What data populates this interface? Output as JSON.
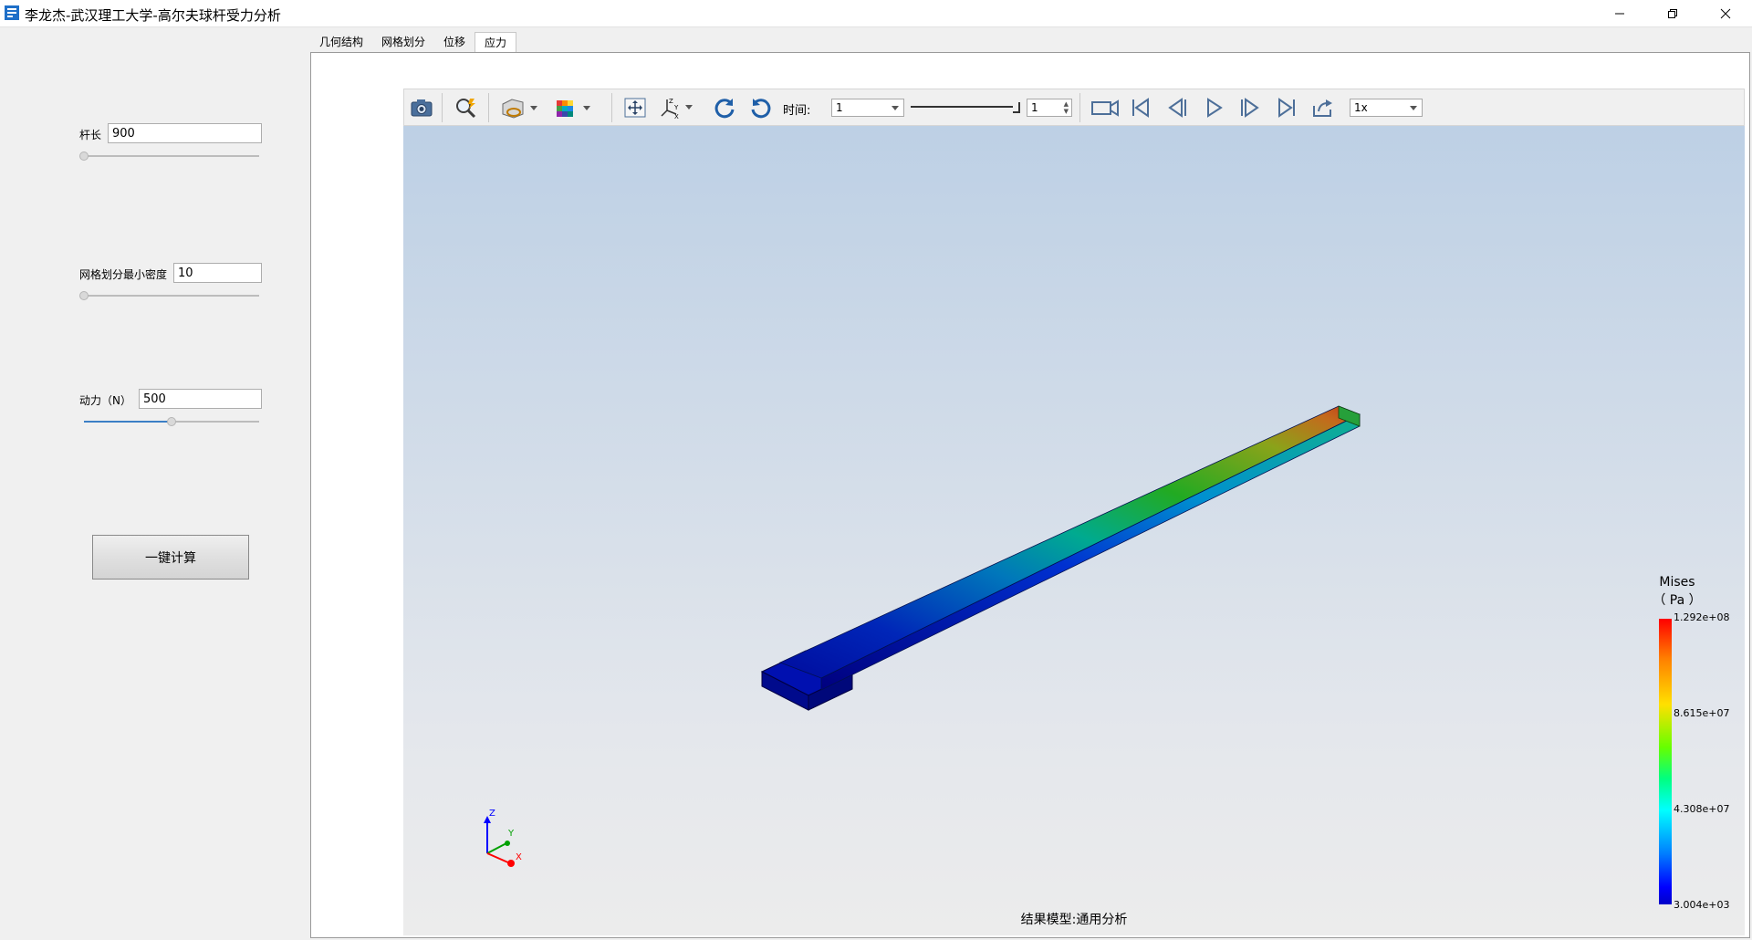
{
  "window": {
    "title": "李龙杰-武汉理工大学-高尔夫球杆受力分析",
    "icon": "app-icon"
  },
  "params": {
    "rod_length": {
      "label": "杆长",
      "value": "900",
      "slider_fraction": 0.0
    },
    "mesh_density": {
      "label": "网格划分最小密度",
      "value": "10",
      "slider_fraction": 0.0
    },
    "force": {
      "label": "动力（N）",
      "value": "500",
      "slider_fraction": 0.5
    }
  },
  "calc_button": {
    "label": "一键计算"
  },
  "tabs": [
    {
      "label": "几何结构",
      "active": false
    },
    {
      "label": "网格划分",
      "active": false
    },
    {
      "label": "位移",
      "active": false
    },
    {
      "label": "应力",
      "active": true
    }
  ],
  "toolbar": {
    "time_label": "时间:",
    "time_value": "1",
    "step_value": "1",
    "speed_value": "1x",
    "icons": [
      "camera-icon",
      "zoom-icon",
      "view-cube-icon",
      "color-map-icon",
      "fit-view-icon",
      "axes-icon",
      "rotate-cw-icon",
      "rotate-ccw-icon",
      "record-icon",
      "first-frame-icon",
      "prev-frame-icon",
      "play-icon",
      "next-frame-icon",
      "last-frame-icon",
      "export-icon"
    ]
  },
  "viewport": {
    "result_caption": "结果模型:通用分析",
    "axes": {
      "x": "X",
      "y": "Y",
      "z": "Z"
    }
  },
  "legend": {
    "title": "Mises",
    "unit": "（ Pa ）",
    "ticks": [
      "1.292e+08",
      "8.615e+07",
      "4.308e+07",
      "3.004e+03"
    ]
  },
  "colors": {
    "accent": "#3c7fc6",
    "viewport_top": "#bdd0e5",
    "viewport_bottom": "#ececec"
  }
}
